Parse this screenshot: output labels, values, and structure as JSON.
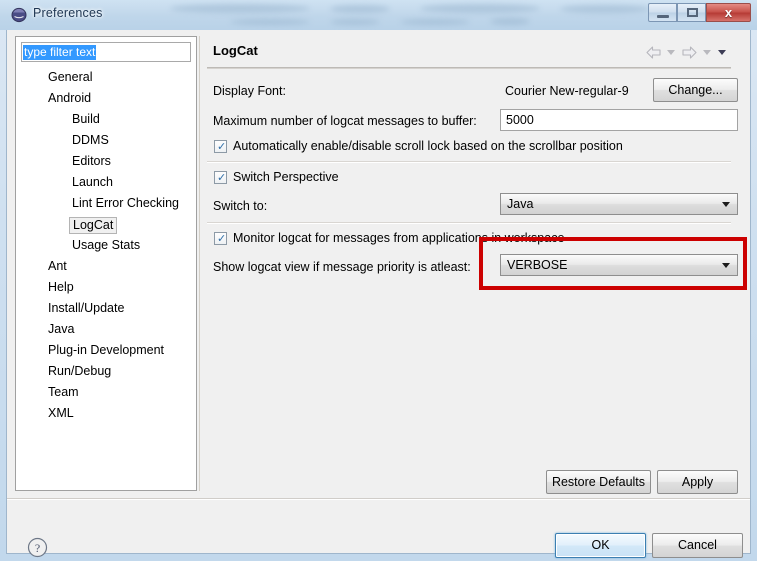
{
  "window": {
    "title": "Preferences",
    "icon": "eclipse-sphere-icon",
    "controls": {
      "minimize": "–",
      "maximize": "□",
      "close": "x"
    }
  },
  "sidebar": {
    "filter": {
      "value": "type filter text",
      "placeholder": "type filter text"
    },
    "items": [
      {
        "label": "General",
        "level": 1,
        "selected": false
      },
      {
        "label": "Android",
        "level": 1,
        "selected": false
      },
      {
        "label": "Build",
        "level": 2,
        "selected": false
      },
      {
        "label": "DDMS",
        "level": 2,
        "selected": false
      },
      {
        "label": "Editors",
        "level": 2,
        "selected": false
      },
      {
        "label": "Launch",
        "level": 2,
        "selected": false
      },
      {
        "label": "Lint Error Checking",
        "level": 2,
        "selected": false
      },
      {
        "label": "LogCat",
        "level": 2,
        "selected": true
      },
      {
        "label": "Usage Stats",
        "level": 2,
        "selected": false
      },
      {
        "label": "Ant",
        "level": 1,
        "selected": false
      },
      {
        "label": "Help",
        "level": 1,
        "selected": false
      },
      {
        "label": "Install/Update",
        "level": 1,
        "selected": false
      },
      {
        "label": "Java",
        "level": 1,
        "selected": false
      },
      {
        "label": "Plug-in Development",
        "level": 1,
        "selected": false
      },
      {
        "label": "Run/Debug",
        "level": 1,
        "selected": false
      },
      {
        "label": "Team",
        "level": 1,
        "selected": false
      },
      {
        "label": "XML",
        "level": 1,
        "selected": false
      }
    ]
  },
  "content": {
    "title": "LogCat",
    "nav": {
      "back": "back-arrow-icon",
      "back_menu": "chevron-down-icon",
      "forward": "forward-arrow-icon",
      "forward_menu": "chevron-down-icon",
      "view_menu": "chevron-down-icon"
    },
    "display_font": {
      "label": "Display Font:",
      "value": "Courier New-regular-9",
      "button": "Change..."
    },
    "buffer": {
      "label": "Maximum number of logcat messages to buffer:",
      "value": "5000"
    },
    "scroll_lock": {
      "label": "Automatically enable/disable scroll lock based on the scrollbar position",
      "checked": true,
      "mark": "✓"
    },
    "switch_perspective": {
      "label": "Switch Perspective",
      "checked": true,
      "mark": "✓"
    },
    "switch_to": {
      "label": "Switch to:",
      "value": "Java"
    },
    "monitor_logcat": {
      "label": "Monitor logcat for messages from applications in workspace",
      "checked": true,
      "mark": "✓"
    },
    "priority": {
      "label": "Show logcat view if message priority is atleast:",
      "value": "VERBOSE"
    }
  },
  "buttons": {
    "restore_defaults": "Restore Defaults",
    "apply": "Apply",
    "ok": "OK",
    "cancel": "Cancel"
  },
  "help": {
    "icon": "question-mark-icon",
    "glyph": "?"
  },
  "colors": {
    "annotation": "#cc0000",
    "selection": "#3399ff",
    "close_button": "#c8534c",
    "checkbox_tick": "#2f6fa8"
  }
}
